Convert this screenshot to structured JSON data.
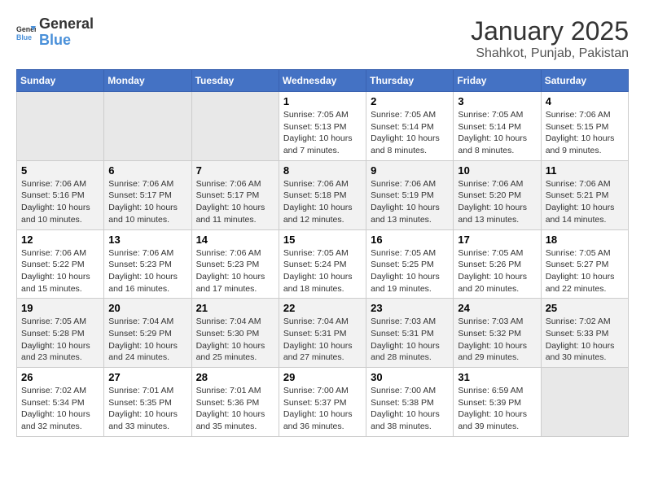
{
  "header": {
    "logo_line1": "General",
    "logo_line2": "Blue",
    "title": "January 2025",
    "subtitle": "Shahkot, Punjab, Pakistan"
  },
  "days_of_week": [
    "Sunday",
    "Monday",
    "Tuesday",
    "Wednesday",
    "Thursday",
    "Friday",
    "Saturday"
  ],
  "weeks": [
    {
      "cells": [
        {
          "empty": true
        },
        {
          "empty": true
        },
        {
          "empty": true
        },
        {
          "day": 1,
          "sunrise": "7:05 AM",
          "sunset": "5:13 PM",
          "daylight": "10 hours and 7 minutes."
        },
        {
          "day": 2,
          "sunrise": "7:05 AM",
          "sunset": "5:14 PM",
          "daylight": "10 hours and 8 minutes."
        },
        {
          "day": 3,
          "sunrise": "7:05 AM",
          "sunset": "5:14 PM",
          "daylight": "10 hours and 8 minutes."
        },
        {
          "day": 4,
          "sunrise": "7:06 AM",
          "sunset": "5:15 PM",
          "daylight": "10 hours and 9 minutes."
        }
      ]
    },
    {
      "cells": [
        {
          "day": 5,
          "sunrise": "7:06 AM",
          "sunset": "5:16 PM",
          "daylight": "10 hours and 10 minutes."
        },
        {
          "day": 6,
          "sunrise": "7:06 AM",
          "sunset": "5:17 PM",
          "daylight": "10 hours and 10 minutes."
        },
        {
          "day": 7,
          "sunrise": "7:06 AM",
          "sunset": "5:17 PM",
          "daylight": "10 hours and 11 minutes."
        },
        {
          "day": 8,
          "sunrise": "7:06 AM",
          "sunset": "5:18 PM",
          "daylight": "10 hours and 12 minutes."
        },
        {
          "day": 9,
          "sunrise": "7:06 AM",
          "sunset": "5:19 PM",
          "daylight": "10 hours and 13 minutes."
        },
        {
          "day": 10,
          "sunrise": "7:06 AM",
          "sunset": "5:20 PM",
          "daylight": "10 hours and 13 minutes."
        },
        {
          "day": 11,
          "sunrise": "7:06 AM",
          "sunset": "5:21 PM",
          "daylight": "10 hours and 14 minutes."
        }
      ]
    },
    {
      "cells": [
        {
          "day": 12,
          "sunrise": "7:06 AM",
          "sunset": "5:22 PM",
          "daylight": "10 hours and 15 minutes."
        },
        {
          "day": 13,
          "sunrise": "7:06 AM",
          "sunset": "5:23 PM",
          "daylight": "10 hours and 16 minutes."
        },
        {
          "day": 14,
          "sunrise": "7:06 AM",
          "sunset": "5:23 PM",
          "daylight": "10 hours and 17 minutes."
        },
        {
          "day": 15,
          "sunrise": "7:05 AM",
          "sunset": "5:24 PM",
          "daylight": "10 hours and 18 minutes."
        },
        {
          "day": 16,
          "sunrise": "7:05 AM",
          "sunset": "5:25 PM",
          "daylight": "10 hours and 19 minutes."
        },
        {
          "day": 17,
          "sunrise": "7:05 AM",
          "sunset": "5:26 PM",
          "daylight": "10 hours and 20 minutes."
        },
        {
          "day": 18,
          "sunrise": "7:05 AM",
          "sunset": "5:27 PM",
          "daylight": "10 hours and 22 minutes."
        }
      ]
    },
    {
      "cells": [
        {
          "day": 19,
          "sunrise": "7:05 AM",
          "sunset": "5:28 PM",
          "daylight": "10 hours and 23 minutes."
        },
        {
          "day": 20,
          "sunrise": "7:04 AM",
          "sunset": "5:29 PM",
          "daylight": "10 hours and 24 minutes."
        },
        {
          "day": 21,
          "sunrise": "7:04 AM",
          "sunset": "5:30 PM",
          "daylight": "10 hours and 25 minutes."
        },
        {
          "day": 22,
          "sunrise": "7:04 AM",
          "sunset": "5:31 PM",
          "daylight": "10 hours and 27 minutes."
        },
        {
          "day": 23,
          "sunrise": "7:03 AM",
          "sunset": "5:31 PM",
          "daylight": "10 hours and 28 minutes."
        },
        {
          "day": 24,
          "sunrise": "7:03 AM",
          "sunset": "5:32 PM",
          "daylight": "10 hours and 29 minutes."
        },
        {
          "day": 25,
          "sunrise": "7:02 AM",
          "sunset": "5:33 PM",
          "daylight": "10 hours and 30 minutes."
        }
      ]
    },
    {
      "cells": [
        {
          "day": 26,
          "sunrise": "7:02 AM",
          "sunset": "5:34 PM",
          "daylight": "10 hours and 32 minutes."
        },
        {
          "day": 27,
          "sunrise": "7:01 AM",
          "sunset": "5:35 PM",
          "daylight": "10 hours and 33 minutes."
        },
        {
          "day": 28,
          "sunrise": "7:01 AM",
          "sunset": "5:36 PM",
          "daylight": "10 hours and 35 minutes."
        },
        {
          "day": 29,
          "sunrise": "7:00 AM",
          "sunset": "5:37 PM",
          "daylight": "10 hours and 36 minutes."
        },
        {
          "day": 30,
          "sunrise": "7:00 AM",
          "sunset": "5:38 PM",
          "daylight": "10 hours and 38 minutes."
        },
        {
          "day": 31,
          "sunrise": "6:59 AM",
          "sunset": "5:39 PM",
          "daylight": "10 hours and 39 minutes."
        },
        {
          "empty": true
        }
      ]
    }
  ],
  "labels": {
    "sunrise": "Sunrise:",
    "sunset": "Sunset:",
    "daylight": "Daylight:"
  }
}
